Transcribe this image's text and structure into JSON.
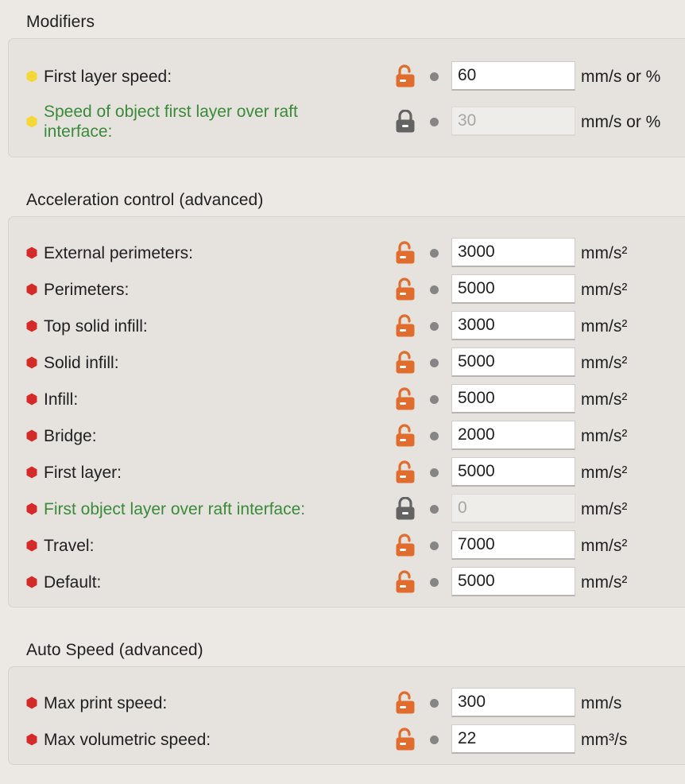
{
  "colors": {
    "window_bg": "#ece9e4",
    "group_bg": "#e6e3de",
    "simple_mode_bullet": "#f5d838",
    "advanced_mode_bullet": "#d42a2a",
    "unlocked_lock": "#e06d2d",
    "locked_lock": "#636363",
    "system_value_label": "#3a8a3a"
  },
  "sections": [
    {
      "title": "Modifiers",
      "rows": [
        {
          "label": "First layer speed:",
          "value": "60",
          "unit": "mm/s or %",
          "bullet": "yellow-circle",
          "lock": "unlocked",
          "label_color": "default",
          "disabled": false
        },
        {
          "label": "Speed of object first layer over raft interface:",
          "label_line1": "Speed of object first layer over raft",
          "label_line2": "interface:",
          "value": "30",
          "unit": "mm/s or %",
          "bullet": "yellow-circle",
          "lock": "locked",
          "label_color": "green",
          "disabled": true
        }
      ]
    },
    {
      "title": "Acceleration control (advanced)",
      "rows": [
        {
          "label": "External perimeters:",
          "value": "3000",
          "unit": "mm/s²",
          "bullet": "red-hexagon",
          "lock": "unlocked",
          "label_color": "default",
          "disabled": false
        },
        {
          "label": "Perimeters:",
          "value": "5000",
          "unit": "mm/s²",
          "bullet": "red-hexagon",
          "lock": "unlocked",
          "label_color": "default",
          "disabled": false
        },
        {
          "label": "Top solid infill:",
          "value": "3000",
          "unit": "mm/s²",
          "bullet": "red-hexagon",
          "lock": "unlocked",
          "label_color": "default",
          "disabled": false
        },
        {
          "label": "Solid infill:",
          "value": "5000",
          "unit": "mm/s²",
          "bullet": "red-hexagon",
          "lock": "unlocked",
          "label_color": "default",
          "disabled": false
        },
        {
          "label": "Infill:",
          "value": "5000",
          "unit": "mm/s²",
          "bullet": "red-hexagon",
          "lock": "unlocked",
          "label_color": "default",
          "disabled": false
        },
        {
          "label": "Bridge:",
          "value": "2000",
          "unit": "mm/s²",
          "bullet": "red-hexagon",
          "lock": "unlocked",
          "label_color": "default",
          "disabled": false
        },
        {
          "label": "First layer:",
          "value": "5000",
          "unit": "mm/s²",
          "bullet": "red-hexagon",
          "lock": "unlocked",
          "label_color": "default",
          "disabled": false
        },
        {
          "label": "First object layer over raft interface:",
          "value": "0",
          "unit": "mm/s²",
          "bullet": "red-hexagon",
          "lock": "locked",
          "label_color": "green",
          "disabled": true
        },
        {
          "label": "Travel:",
          "value": "7000",
          "unit": "mm/s²",
          "bullet": "red-hexagon",
          "lock": "unlocked",
          "label_color": "default",
          "disabled": false
        },
        {
          "label": "Default:",
          "value": "5000",
          "unit": "mm/s²",
          "bullet": "red-hexagon",
          "lock": "unlocked",
          "label_color": "default",
          "disabled": false
        }
      ]
    },
    {
      "title": "Auto Speed (advanced)",
      "rows": [
        {
          "label": "Max print speed:",
          "value": "300",
          "unit": "mm/s",
          "bullet": "red-hexagon",
          "lock": "unlocked",
          "label_color": "default",
          "disabled": false
        },
        {
          "label": "Max volumetric speed:",
          "value": "22",
          "unit": "mm³/s",
          "bullet": "red-hexagon",
          "lock": "unlocked",
          "label_color": "default",
          "disabled": false
        }
      ]
    }
  ]
}
